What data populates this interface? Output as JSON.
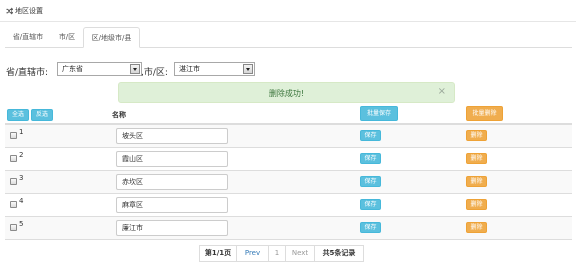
{
  "header": {
    "title": "地区设置",
    "title_icon": "shuffle-icon"
  },
  "tabs": [
    {
      "label": "省/直辖市",
      "active": false
    },
    {
      "label": "市/区",
      "active": false
    },
    {
      "label": "区/地级市/县",
      "active": true
    }
  ],
  "filter": {
    "province_label": "省/直辖市:",
    "province_value": "广东省",
    "city_label": ",市/区:",
    "city_value": "湛江市"
  },
  "alert": {
    "message": "删除成功!",
    "close_symbol": "×",
    "color": "#3c763d"
  },
  "table": {
    "select_all_label": "全选",
    "invert_label": "反选",
    "name_header": "名称",
    "batch_save_label": "批量保存",
    "batch_delete_label": "批量删除",
    "rows": [
      {
        "index": "1",
        "name": "坡头区",
        "save_label": "保存",
        "delete_label": "删除"
      },
      {
        "index": "2",
        "name": "霞山区",
        "save_label": "保存",
        "delete_label": "删除"
      },
      {
        "index": "3",
        "name": "赤坎区",
        "save_label": "保存",
        "delete_label": "删除"
      },
      {
        "index": "4",
        "name": "麻章区",
        "save_label": "保存",
        "delete_label": "删除"
      },
      {
        "index": "5",
        "name": "廉江市",
        "save_label": "保存",
        "delete_label": "删除"
      }
    ]
  },
  "pagination": {
    "page_info": "第1/1页",
    "prev_label": "Prev",
    "current_page": "1",
    "next_label": "Next",
    "total_label": "共5条记录"
  },
  "colors": {
    "info": "#5bc0de",
    "warning": "#f0ad4e",
    "success_bg": "#dff0d8"
  }
}
